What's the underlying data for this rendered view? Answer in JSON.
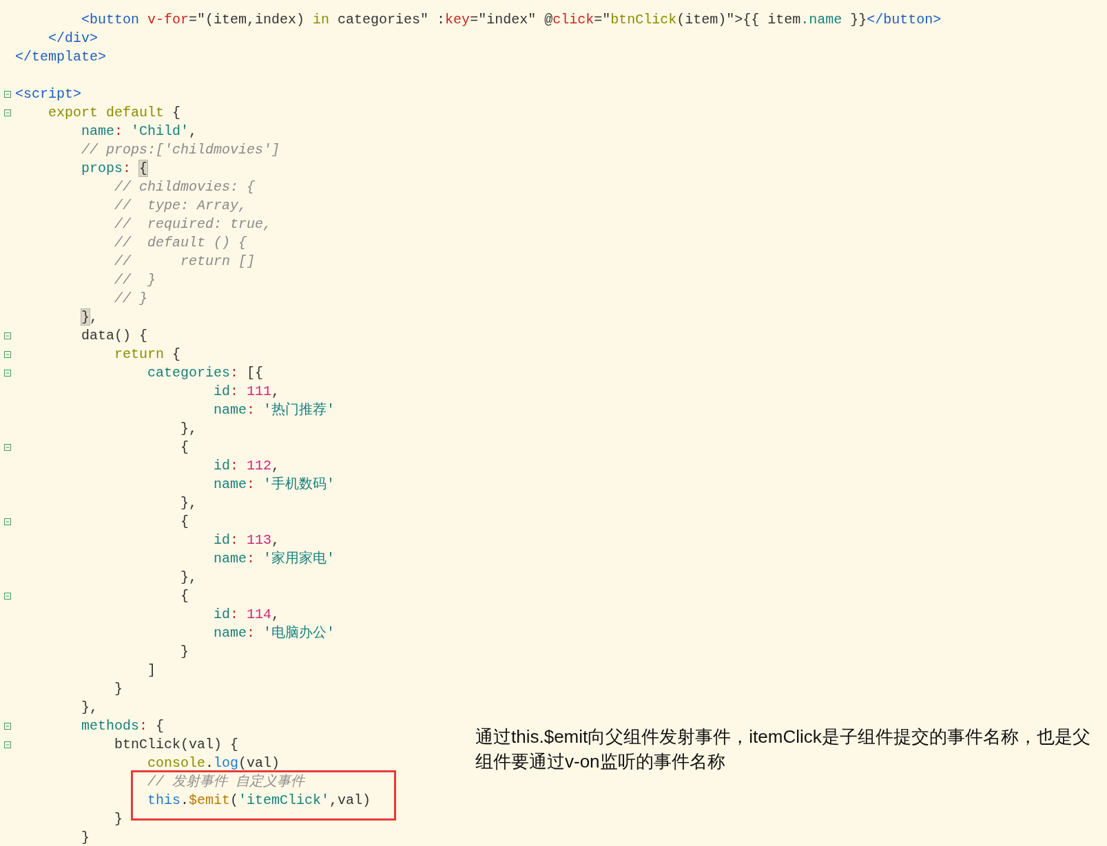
{
  "editor": {
    "lines": [
      {
        "fold": false,
        "tokens": [
          {
            "kind": "tag",
            "text": "        <button"
          },
          {
            "kind": "attr",
            "text": " v-for"
          },
          {
            "kind": "plain",
            "text": "=\"(item,index) "
          },
          {
            "kind": "keyword",
            "text": "in"
          },
          {
            "kind": "plain",
            "text": " categories\" :"
          },
          {
            "kind": "attr",
            "text": "key"
          },
          {
            "kind": "plain",
            "text": "=\"index\" @"
          },
          {
            "kind": "attr",
            "text": "click"
          },
          {
            "kind": "plain",
            "text": "=\""
          },
          {
            "kind": "keyword",
            "text": "btnClick"
          },
          {
            "kind": "plain",
            "text": "(item)\">{{ item"
          },
          {
            "kind": "property",
            "text": ".name"
          },
          {
            "kind": "plain",
            "text": " }}"
          },
          {
            "kind": "tag",
            "text": "</button>"
          }
        ]
      },
      {
        "fold": false,
        "tokens": [
          {
            "kind": "tag",
            "text": "    </div>"
          }
        ]
      },
      {
        "fold": false,
        "tokens": [
          {
            "kind": "tag",
            "text": "</template>"
          }
        ]
      },
      {
        "fold": false
      },
      {
        "fold": true,
        "tokens": [
          {
            "kind": "tag",
            "text": "<script>"
          }
        ]
      },
      {
        "fold": true,
        "tokens": [
          {
            "kind": "keyword",
            "text": "    export default"
          },
          {
            "kind": "plain",
            "text": " {"
          }
        ]
      },
      {
        "fold": false,
        "tokens": [
          {
            "kind": "property",
            "text": "        name"
          },
          {
            "kind": "colon",
            "text": ": "
          },
          {
            "kind": "string",
            "text": "'Child'"
          },
          {
            "kind": "plain",
            "text": ","
          }
        ]
      },
      {
        "fold": false,
        "tokens": [
          {
            "kind": "comment",
            "text": "        // props:['childmovies']"
          }
        ]
      },
      {
        "fold": false,
        "tokens": [
          {
            "kind": "property",
            "text": "        props"
          },
          {
            "kind": "colon",
            "text": ": "
          },
          {
            "kind": "match",
            "text": "{"
          }
        ]
      },
      {
        "fold": false,
        "tokens": [
          {
            "kind": "comment",
            "text": "            // childmovies: {"
          }
        ]
      },
      {
        "fold": false,
        "tokens": [
          {
            "kind": "comment",
            "text": "            //  type: Array,"
          }
        ]
      },
      {
        "fold": false,
        "tokens": [
          {
            "kind": "comment",
            "text": "            //  required: true,"
          }
        ]
      },
      {
        "fold": false,
        "tokens": [
          {
            "kind": "comment",
            "text": "            //  default () {"
          }
        ]
      },
      {
        "fold": false,
        "tokens": [
          {
            "kind": "comment",
            "text": "            //      return []"
          }
        ]
      },
      {
        "fold": false,
        "tokens": [
          {
            "kind": "comment",
            "text": "            //  }"
          }
        ]
      },
      {
        "fold": false,
        "tokens": [
          {
            "kind": "comment",
            "text": "            // }"
          }
        ]
      },
      {
        "fold": false,
        "tokens": [
          {
            "kind": "match",
            "text": "        }"
          },
          {
            "kind": "plain",
            "text": ","
          }
        ]
      },
      {
        "fold": true,
        "tokens": [
          {
            "kind": "plain",
            "text": "        data() {"
          }
        ]
      },
      {
        "fold": true,
        "tokens": [
          {
            "kind": "keyword",
            "text": "            return"
          },
          {
            "kind": "plain",
            "text": " {"
          }
        ]
      },
      {
        "fold": true,
        "tokens": [
          {
            "kind": "property",
            "text": "                categories"
          },
          {
            "kind": "colon",
            "text": ": "
          },
          {
            "kind": "plain",
            "text": "[{"
          }
        ]
      },
      {
        "fold": false,
        "tokens": [
          {
            "kind": "property",
            "text": "                        id"
          },
          {
            "kind": "colon",
            "text": ": "
          },
          {
            "kind": "number",
            "text": "111"
          },
          {
            "kind": "plain",
            "text": ","
          }
        ]
      },
      {
        "fold": false,
        "tokens": [
          {
            "kind": "property",
            "text": "                        name"
          },
          {
            "kind": "colon",
            "text": ": "
          },
          {
            "kind": "string",
            "text": "'热门推荐'"
          }
        ]
      },
      {
        "fold": false,
        "tokens": [
          {
            "kind": "plain",
            "text": "                    },"
          }
        ]
      },
      {
        "fold": true,
        "tokens": [
          {
            "kind": "plain",
            "text": "                    {"
          }
        ]
      },
      {
        "fold": false,
        "tokens": [
          {
            "kind": "property",
            "text": "                        id"
          },
          {
            "kind": "colon",
            "text": ": "
          },
          {
            "kind": "number",
            "text": "112"
          },
          {
            "kind": "plain",
            "text": ","
          }
        ]
      },
      {
        "fold": false,
        "tokens": [
          {
            "kind": "property",
            "text": "                        name"
          },
          {
            "kind": "colon",
            "text": ": "
          },
          {
            "kind": "string",
            "text": "'手机数码'"
          }
        ]
      },
      {
        "fold": false,
        "tokens": [
          {
            "kind": "plain",
            "text": "                    },"
          }
        ]
      },
      {
        "fold": true,
        "tokens": [
          {
            "kind": "plain",
            "text": "                    {"
          }
        ]
      },
      {
        "fold": false,
        "tokens": [
          {
            "kind": "property",
            "text": "                        id"
          },
          {
            "kind": "colon",
            "text": ": "
          },
          {
            "kind": "number",
            "text": "113"
          },
          {
            "kind": "plain",
            "text": ","
          }
        ]
      },
      {
        "fold": false,
        "tokens": [
          {
            "kind": "property",
            "text": "                        name"
          },
          {
            "kind": "colon",
            "text": ": "
          },
          {
            "kind": "string",
            "text": "'家用家电'"
          }
        ]
      },
      {
        "fold": false,
        "tokens": [
          {
            "kind": "plain",
            "text": "                    },"
          }
        ]
      },
      {
        "fold": true,
        "tokens": [
          {
            "kind": "plain",
            "text": "                    {"
          }
        ]
      },
      {
        "fold": false,
        "tokens": [
          {
            "kind": "property",
            "text": "                        id"
          },
          {
            "kind": "colon",
            "text": ": "
          },
          {
            "kind": "number",
            "text": "114"
          },
          {
            "kind": "plain",
            "text": ","
          }
        ]
      },
      {
        "fold": false,
        "tokens": [
          {
            "kind": "property",
            "text": "                        name"
          },
          {
            "kind": "colon",
            "text": ": "
          },
          {
            "kind": "string",
            "text": "'电脑办公'"
          }
        ]
      },
      {
        "fold": false,
        "tokens": [
          {
            "kind": "plain",
            "text": "                    }"
          }
        ]
      },
      {
        "fold": false,
        "tokens": [
          {
            "kind": "plain",
            "text": "                ]"
          }
        ]
      },
      {
        "fold": false,
        "tokens": [
          {
            "kind": "plain",
            "text": "            }"
          }
        ]
      },
      {
        "fold": false,
        "tokens": [
          {
            "kind": "plain",
            "text": "        },"
          }
        ]
      },
      {
        "fold": true,
        "tokens": [
          {
            "kind": "property",
            "text": "        methods"
          },
          {
            "kind": "colon",
            "text": ": "
          },
          {
            "kind": "plain",
            "text": "{"
          }
        ]
      },
      {
        "fold": true,
        "tokens": [
          {
            "kind": "plain",
            "text": "            btnClick(val) {"
          }
        ]
      },
      {
        "fold": false,
        "tokens": [
          {
            "kind": "keyword",
            "text": "                console"
          },
          {
            "kind": "plain",
            "text": "."
          },
          {
            "kind": "function",
            "text": "log"
          },
          {
            "kind": "plain",
            "text": "(val)"
          }
        ]
      },
      {
        "fold": false,
        "tokens": [
          {
            "kind": "faint",
            "text": "                // 发射事件 自定义事件"
          }
        ]
      },
      {
        "fold": false,
        "tokens": [
          {
            "kind": "function",
            "text": "                this"
          },
          {
            "kind": "plain",
            "text": "."
          },
          {
            "kind": "emit",
            "text": "$emit"
          },
          {
            "kind": "plain",
            "text": "("
          },
          {
            "kind": "string",
            "text": "'itemClick'"
          },
          {
            "kind": "plain",
            "text": ",val)"
          }
        ]
      },
      {
        "fold": false,
        "tokens": [
          {
            "kind": "plain",
            "text": "            }"
          }
        ]
      },
      {
        "fold": false,
        "tokens": [
          {
            "kind": "plain",
            "text": "        }"
          }
        ]
      }
    ]
  },
  "annotation": {
    "text": "通过this.$emit向父组件发射事件，itemClick是子组件提交的事件名称，也是父组件要通过v-on监听的事件名称"
  }
}
